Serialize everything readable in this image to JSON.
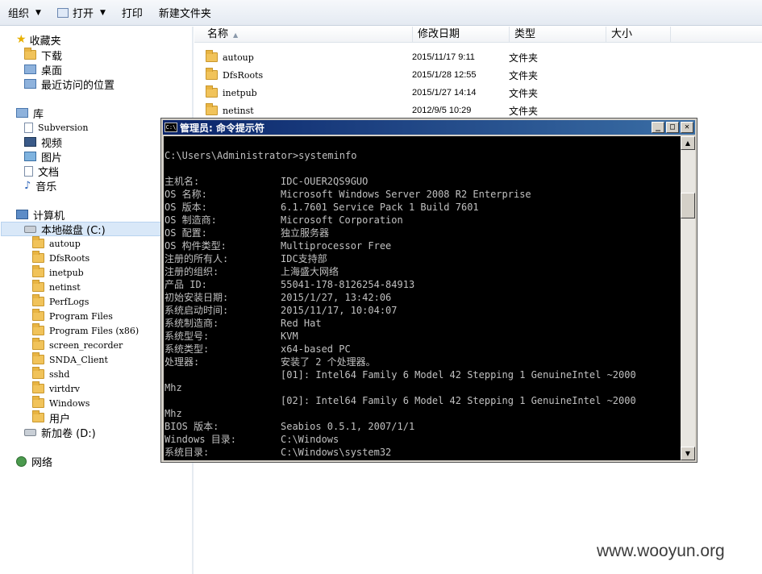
{
  "toolbar": {
    "organize": "组织",
    "open": "打开",
    "print": "打印",
    "new_folder": "新建文件夹"
  },
  "nav": {
    "favorites": "收藏夹",
    "downloads": "下载",
    "desktop": "桌面",
    "recent": "最近访问的位置",
    "libraries": "库",
    "subversion": "Subversion",
    "videos": "视频",
    "pictures": "图片",
    "documents": "文档",
    "music": "音乐",
    "computer": "计算机",
    "local_disk": "本地磁盘 (C:)",
    "c_folders": [
      "autoup",
      "DfsRoots",
      "inetpub",
      "netinst",
      "PerfLogs",
      "Program Files",
      "Program Files (x86)",
      "screen_recorder",
      "SNDA_Client",
      "sshd",
      "virtdrv",
      "Windows",
      "用户"
    ],
    "new_volume": "新加卷 (D:)",
    "network": "网络"
  },
  "columns": {
    "name": "名称",
    "modified": "修改日期",
    "type": "类型",
    "size": "大小"
  },
  "files": [
    {
      "name": "autoup",
      "date": "2015/11/17 9:11",
      "type": "文件夹"
    },
    {
      "name": "DfsRoots",
      "date": "2015/1/28 12:55",
      "type": "文件夹"
    },
    {
      "name": "inetpub",
      "date": "2015/1/27 14:14",
      "type": "文件夹"
    },
    {
      "name": "netinst",
      "date": "2012/9/5 10:29",
      "type": "文件夹"
    }
  ],
  "cmd": {
    "title": "管理员: 命令提示符",
    "icon_text": "C:\\",
    "command": "C:\\Users\\Administrator>systeminfo",
    "rows": [
      {
        "k": "主机名:",
        "v": "IDC-OUER2QS9GUO"
      },
      {
        "k": "OS 名称:",
        "v": "Microsoft Windows Server 2008 R2 Enterprise"
      },
      {
        "k": "OS 版本:",
        "v": "6.1.7601 Service Pack 1 Build 7601"
      },
      {
        "k": "OS 制造商:",
        "v": "Microsoft Corporation"
      },
      {
        "k": "OS 配置:",
        "v": "独立服务器"
      },
      {
        "k": "OS 构件类型:",
        "v": "Multiprocessor Free"
      },
      {
        "k": "注册的所有人:",
        "v": "IDC支持部"
      },
      {
        "k": "注册的组织:",
        "v": "上海盛大网络"
      },
      {
        "k": "产品 ID:",
        "v": "55041-178-8126254-84913"
      },
      {
        "k": "初始安装日期:",
        "v": "2015/1/27, 13:42:06"
      },
      {
        "k": "系统启动时间:",
        "v": "2015/11/17, 10:04:07"
      },
      {
        "k": "系统制造商:",
        "v": "Red Hat"
      },
      {
        "k": "系统型号:",
        "v": "KVM"
      },
      {
        "k": "系统类型:",
        "v": "x64-based PC"
      },
      {
        "k": "处理器:",
        "v": "安装了 2 个处理器。"
      },
      {
        "k": "",
        "v": "[01]: Intel64 Family 6 Model 42 Stepping 1 GenuineIntel ~2000"
      },
      {
        "k": "Mhz",
        "v": ""
      },
      {
        "k": "",
        "v": "[02]: Intel64 Family 6 Model 42 Stepping 1 GenuineIntel ~2000"
      },
      {
        "k": "Mhz",
        "v": ""
      },
      {
        "k": "BIOS 版本:",
        "v": "Seabios 0.5.1, 2007/1/1"
      },
      {
        "k": "Windows 目录:",
        "v": "C:\\Windows"
      },
      {
        "k": "系统目录:",
        "v": "C:\\Windows\\system32"
      }
    ]
  },
  "watermark": "www.wooyun.org"
}
